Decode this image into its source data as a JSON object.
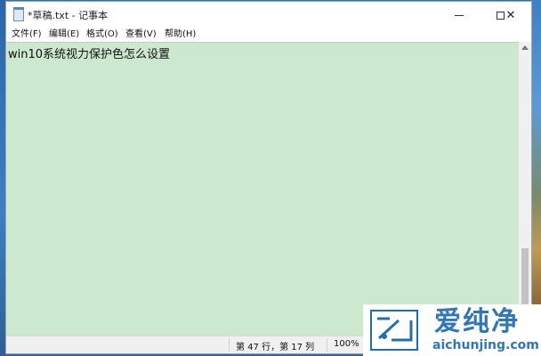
{
  "window": {
    "title": "*草稿.txt - 记事本"
  },
  "menu": {
    "items": [
      "文件(F)",
      "编辑(E)",
      "格式(O)",
      "查看(V)",
      "帮助(H)"
    ]
  },
  "editor": {
    "text": "win10系统视力保护色怎么设置",
    "background": "#cce8cf"
  },
  "status": {
    "position": "第 47 行，第 17 列",
    "zoom": "100%"
  },
  "watermark": {
    "cn": "爱纯净",
    "en": "aichunjing.com",
    "color": "#2f77b9"
  },
  "icons": {
    "app": "notepad-icon",
    "minimize": "minimize-icon",
    "maximize": "maximize-icon",
    "close": "close-icon",
    "scroll_up": "chevron-up-icon",
    "logo": "watermark-logo-icon"
  }
}
